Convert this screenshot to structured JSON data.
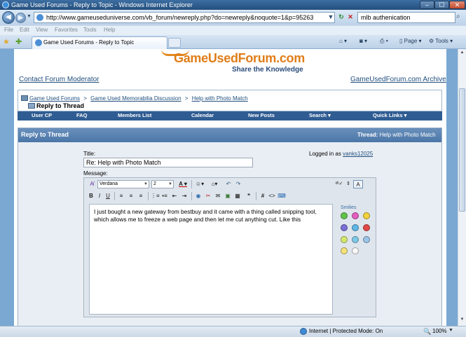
{
  "window": {
    "title": "Game Used Forums - Reply to Topic - Windows Internet Explorer",
    "min": "–",
    "max": "☐",
    "close": "✕"
  },
  "address": {
    "url": "http://www.gameuseduniverse.com/vb_forum/newreply.php?do=newreply&noquote=1&p=95263",
    "search_value": "mlb authenication"
  },
  "menu": [
    "File",
    "Edit",
    "View",
    "Favorites",
    "Tools",
    "Help"
  ],
  "tab": {
    "label": "Game Used Forums - Reply to Topic"
  },
  "commands": {
    "page": "Page",
    "tools": "Tools"
  },
  "site": {
    "logo_text": "GameUsedForum.com",
    "tagline": "Share the Knowledge",
    "contact_link": "Contact Forum Moderator",
    "archive_link": "GameUsedForum.com Archive"
  },
  "breadcrumb": {
    "items": [
      "Game Used Forums",
      "Game Used Memorabilia Discussion",
      "Help with Photo Match"
    ],
    "separator": ">",
    "current": "Reply to Thread"
  },
  "navbar": [
    "User CP",
    "FAQ",
    "Members List",
    "Calendar",
    "New Posts",
    "Search",
    "Quick Links"
  ],
  "thread_panel": {
    "title": "Reply to Thread",
    "thread_label": "Thread:",
    "thread_name": "Help with Photo Match",
    "title_label": "Title:",
    "title_value": "Re: Help with Photo Match",
    "logged_in_label": "Logged in as",
    "logged_in_user": "vanks12025",
    "message_label": "Message:"
  },
  "editor": {
    "font": "Verdana",
    "size": "2",
    "message": "I just bought a new gateway from bestbuy and it came with a thing called snipping tool, which allows me to freeze a web page and then let me cut anything cut. Like this",
    "smilies_title": "Smilies"
  },
  "status": {
    "zone": "Internet | Protected Mode: On",
    "zoom": "100%"
  },
  "colors": {
    "page_bg": "#7aa8d3",
    "navbar": "#2f5c92",
    "logo_orange": "#e07d18",
    "link": "#22507e"
  }
}
